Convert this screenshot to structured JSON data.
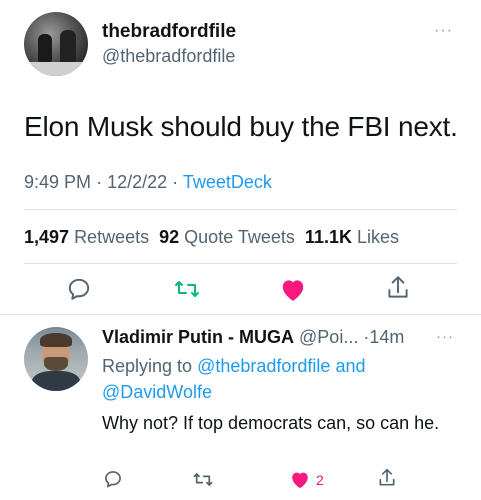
{
  "main_tweet": {
    "display_name": "thebradfordfile",
    "handle": "@thebradfordfile",
    "text": "Elon Musk should buy the FBI next.",
    "time": "9:49 PM",
    "date": "12/2/22",
    "separator": "·",
    "source": "TweetDeck",
    "stats": {
      "retweets_count": "1,497",
      "retweets_label": "Retweets",
      "quotes_count": "92",
      "quotes_label": "Quote Tweets",
      "likes_count": "11.1K",
      "likes_label": "Likes"
    },
    "more": "···"
  },
  "reply_tweet": {
    "display_name": "Vladimir Putin - MUGA",
    "handle": "@Poi...",
    "separator": "·",
    "time_ago": "14m",
    "more": "···",
    "replying_prefix": "Replying to",
    "replying_user1": "@thebradfordfile",
    "replying_and": "and",
    "replying_user2": "@DavidWolfe",
    "text": "Why not? If top democrats can, so can he.",
    "like_count": "2"
  },
  "colors": {
    "accent_blue": "#1d9bf0",
    "retweet_green": "#00ba7c",
    "like_pink": "#f91880",
    "secondary_text": "#536471"
  },
  "icons": [
    "reply-icon",
    "retweet-icon",
    "like-icon",
    "share-icon"
  ]
}
